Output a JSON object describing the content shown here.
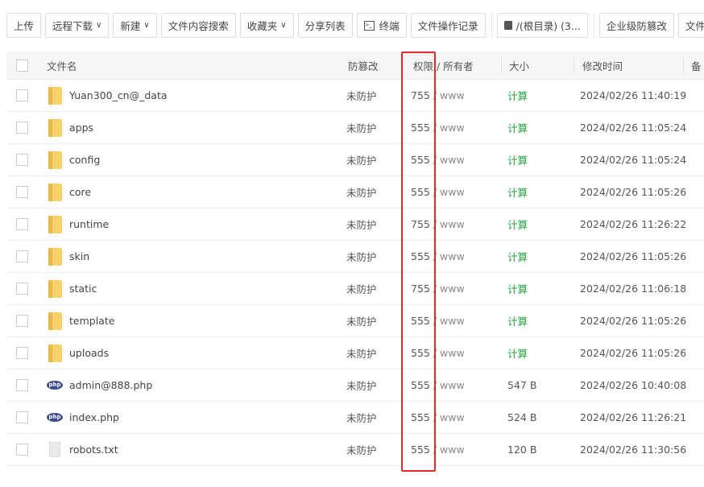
{
  "toolbar": [
    {
      "label": "上传",
      "chevron": false
    },
    {
      "label": "远程下载",
      "chevron": true
    },
    {
      "label": "新建",
      "chevron": true
    },
    {
      "label": "文件内容搜索",
      "chevron": false
    },
    {
      "label": "收藏夹",
      "chevron": true
    },
    {
      "label": "分享列表",
      "chevron": false
    },
    {
      "label": "终端",
      "icon": "terminal-icon",
      "chevron": false
    },
    {
      "label": "文件操作记录",
      "chevron": false
    },
    {
      "label": "/(根目录) (3...",
      "icon": "disk-icon",
      "chevron": false
    },
    {
      "label": "企业级防篡改",
      "chevron": false
    },
    {
      "label": "文件",
      "chevron": false
    }
  ],
  "headers": {
    "name": "文件名",
    "protect": "防篡改",
    "perm": "权限 / 所有者",
    "size": "大小",
    "time": "修改时间",
    "note": "备"
  },
  "files": [
    {
      "name": "Yuan300_cn@_data",
      "type": "folder",
      "protect": "未防护",
      "perm": "755",
      "owner": "www",
      "size": "计算",
      "time": "2024/02/26 11:40:19"
    },
    {
      "name": "apps",
      "type": "folder",
      "protect": "未防护",
      "perm": "555",
      "owner": "www",
      "size": "计算",
      "time": "2024/02/26 11:05:24"
    },
    {
      "name": "config",
      "type": "folder",
      "protect": "未防护",
      "perm": "555",
      "owner": "www",
      "size": "计算",
      "time": "2024/02/26 11:05:24"
    },
    {
      "name": "core",
      "type": "folder",
      "protect": "未防护",
      "perm": "555",
      "owner": "www",
      "size": "计算",
      "time": "2024/02/26 11:05:26"
    },
    {
      "name": "runtime",
      "type": "folder",
      "protect": "未防护",
      "perm": "755",
      "owner": "www",
      "size": "计算",
      "time": "2024/02/26 11:26:22"
    },
    {
      "name": "skin",
      "type": "folder",
      "protect": "未防护",
      "perm": "555",
      "owner": "www",
      "size": "计算",
      "time": "2024/02/26 11:05:26"
    },
    {
      "name": "static",
      "type": "folder",
      "protect": "未防护",
      "perm": "755",
      "owner": "www",
      "size": "计算",
      "time": "2024/02/26 11:06:18"
    },
    {
      "name": "template",
      "type": "folder",
      "protect": "未防护",
      "perm": "555",
      "owner": "www",
      "size": "计算",
      "time": "2024/02/26 11:05:26"
    },
    {
      "name": "uploads",
      "type": "folder",
      "protect": "未防护",
      "perm": "555",
      "owner": "www",
      "size": "计算",
      "time": "2024/02/26 11:05:26"
    },
    {
      "name": "admin@888.php",
      "type": "php",
      "protect": "未防护",
      "perm": "555",
      "owner": "www",
      "size": "547 B",
      "time": "2024/02/26 10:40:08"
    },
    {
      "name": "index.php",
      "type": "php",
      "protect": "未防护",
      "perm": "555",
      "owner": "www",
      "size": "524 B",
      "time": "2024/02/26 11:26:21"
    },
    {
      "name": "robots.txt",
      "type": "txt",
      "protect": "未防护",
      "perm": "555",
      "owner": "www",
      "size": "120 B",
      "time": "2024/02/26 11:30:56"
    }
  ],
  "php_icon_text": "php",
  "colors": {
    "calc": "#20a53a",
    "highlight": "#e02a2a"
  }
}
